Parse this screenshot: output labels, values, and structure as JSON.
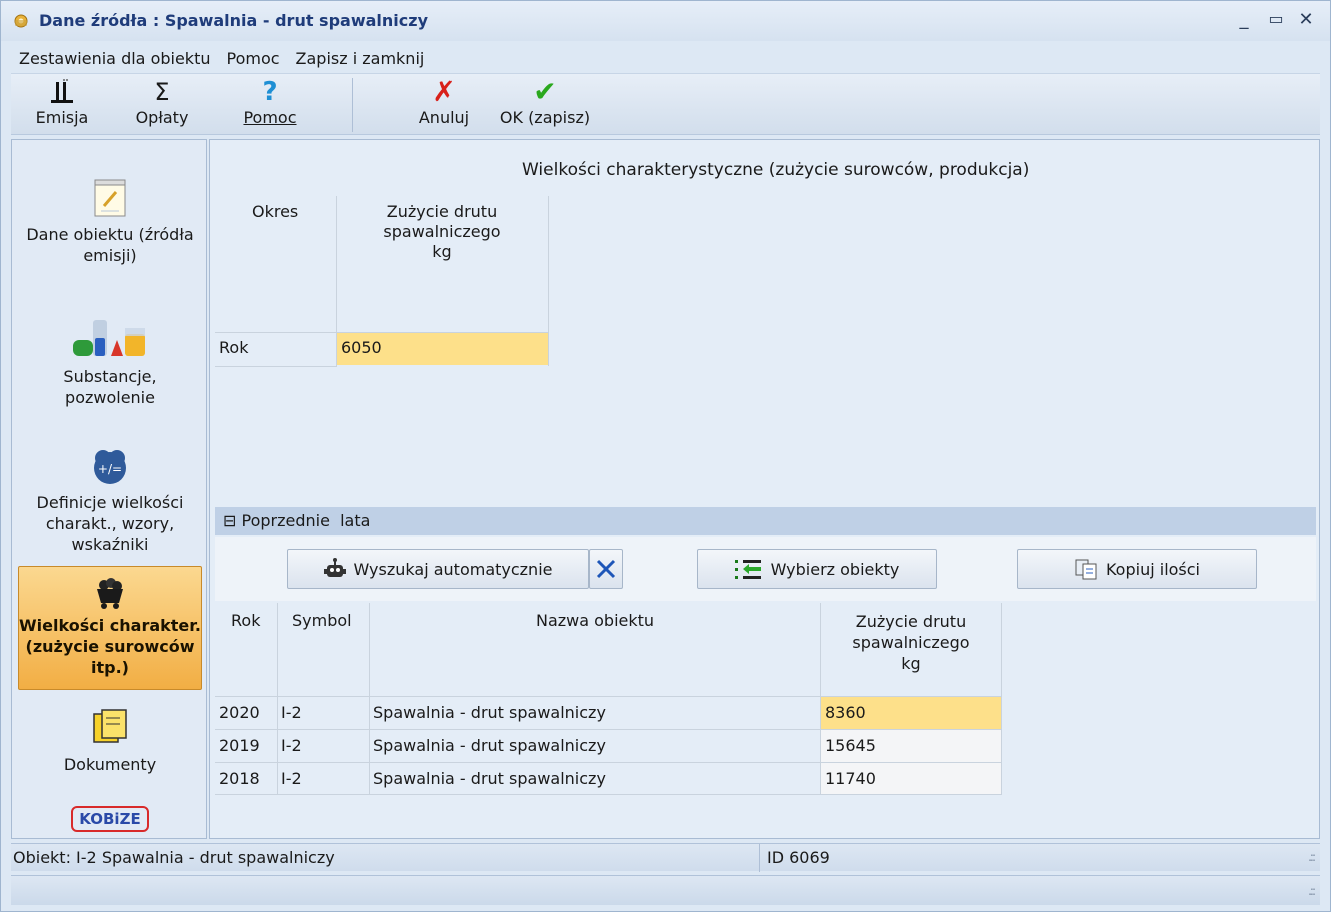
{
  "window": {
    "title": "Dane źródła : Spawalnia - drut spawalniczy",
    "controls": {
      "minimize": "_",
      "maximize": "▭",
      "close": "✕"
    }
  },
  "menu": [
    "Zestawienia dla obiektu",
    "Pomoc",
    "Zapisz i zamknij"
  ],
  "toolbar": {
    "emisja": "Emisja",
    "oplaty": "Opłaty",
    "pomoc": "Pomoc",
    "anuluj": "Anuluj",
    "ok": "OK (zapisz)"
  },
  "nav": {
    "dane_obiektu": "Dane obiektu (źródła emisji)",
    "substancje": "Substancje, pozwolenie",
    "definicje": "Definicje wielkości charakt., wzory, wskaźniki",
    "wielkosci": "Wielkości charakter. (zużycie surowców itp.)",
    "dokumenty": "Dokumenty",
    "logo": "KOBiZE"
  },
  "main": {
    "section_title": "Wielkości charakterystyczne (zużycie surowców, produkcja)",
    "grid": {
      "col_okres": "Okres",
      "col_value_line1": "Zużycie drutu",
      "col_value_line2": "spawalniczego",
      "col_value_unit": "kg",
      "row_label": "Rok",
      "row_value": "6050"
    },
    "previous_years": {
      "toggle": "⊟",
      "label": "Poprzednie  lata",
      "btn_search": "Wyszukaj automatycznie",
      "btn_select": "Wybierz obiekty",
      "btn_copy": "Kopiuj ilości",
      "headers": {
        "rok": "Rok",
        "symbol": "Symbol",
        "nazwa": "Nazwa obiektu",
        "value_line1": "Zużycie drutu",
        "value_line2": "spawalniczego",
        "value_unit": "kg"
      },
      "rows": [
        {
          "rok": "2020",
          "symbol": "I-2",
          "nazwa": "Spawalnia - drut spawalniczy",
          "value": "8360"
        },
        {
          "rok": "2019",
          "symbol": "I-2",
          "nazwa": "Spawalnia - drut spawalniczy",
          "value": "15645"
        },
        {
          "rok": "2018",
          "symbol": "I-2",
          "nazwa": "Spawalnia - drut spawalniczy",
          "value": "11740"
        }
      ]
    }
  },
  "status": {
    "object": "Obiekt: I-2 Spawalnia - drut spawalniczy",
    "id": "ID 6069"
  },
  "colors": {
    "highlight_cell": "#fde08a",
    "active_nav": "#f2ae44",
    "section_bar": "#bfd0e6"
  }
}
